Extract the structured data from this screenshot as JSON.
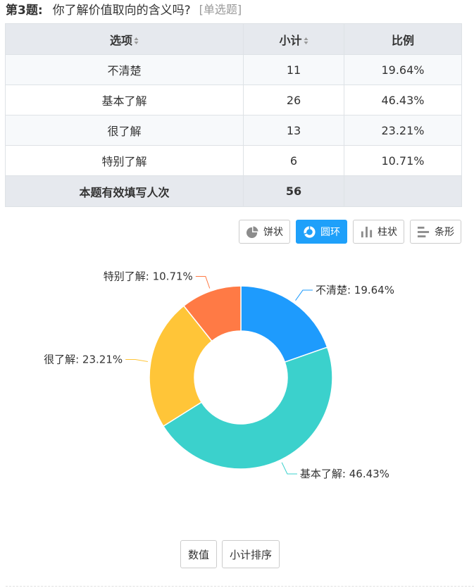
{
  "question": {
    "number": "第3题:",
    "text": "你了解价值取向的含义吗?",
    "type": "[单选题]"
  },
  "table": {
    "headers": {
      "option": "选项",
      "count": "小计",
      "ratio": "比例"
    },
    "rows": [
      {
        "option": "不清楚",
        "count": "11",
        "ratio": "19.64%"
      },
      {
        "option": "基本了解",
        "count": "26",
        "ratio": "46.43%"
      },
      {
        "option": "很了解",
        "count": "13",
        "ratio": "23.21%"
      },
      {
        "option": "特别了解",
        "count": "6",
        "ratio": "10.71%"
      }
    ],
    "footer": {
      "label": "本题有效填写人次",
      "count": "56",
      "ratio": ""
    }
  },
  "chart_buttons": [
    {
      "label": "饼状",
      "icon": "pie-icon",
      "active": false
    },
    {
      "label": "圆环",
      "icon": "donut-icon",
      "active": true
    },
    {
      "label": "柱状",
      "icon": "bar-icon",
      "active": false
    },
    {
      "label": "条形",
      "icon": "horizontal-bar-icon",
      "active": false
    }
  ],
  "bottom_buttons": [
    {
      "label": "数值"
    },
    {
      "label": "小计排序"
    }
  ],
  "colors": {
    "active_button": "#1ea0fa",
    "header_bg": "#e6e9ee"
  },
  "chart_data": {
    "type": "pie",
    "donut": true,
    "slices": [
      {
        "label": "不清楚",
        "value": 19.64,
        "count": 11,
        "display": "不清楚: 19.64%",
        "color": "#1e9bfd"
      },
      {
        "label": "基本了解",
        "value": 46.43,
        "count": 26,
        "display": "基本了解: 46.43%",
        "color": "#3bd1cc"
      },
      {
        "label": "很了解",
        "value": 23.21,
        "count": 13,
        "display": "很了解: 23.21%",
        "color": "#ffc538"
      },
      {
        "label": "特别了解",
        "value": 10.71,
        "count": 6,
        "display": "特别了解: 10.71%",
        "color": "#ff7a45"
      }
    ]
  }
}
